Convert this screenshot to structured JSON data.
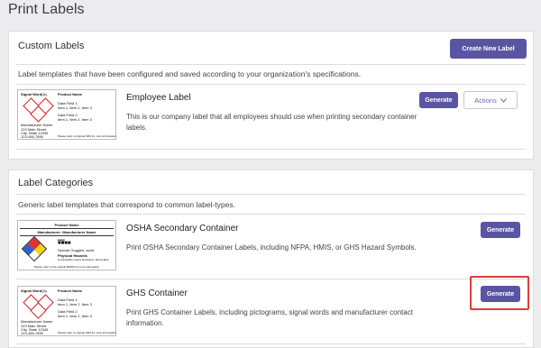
{
  "page": {
    "title": "Print Labels"
  },
  "custom": {
    "title": "Custom Labels",
    "create_label": "Create New Label",
    "description": "Label templates that have been configured and saved according to your organization's specifications.",
    "items": [
      {
        "name": "Employee Label",
        "description": "This is our company label that all employees should use when printing secondary container labels.",
        "generate": "Generate",
        "actions": "Actions",
        "thumb": {
          "signal_word": "Signal Word",
          "qty": "Qty",
          "product_name": "Product Name",
          "data_field_1": "Data Field 1:",
          "items_1": "Item 1, Item 2, Item 3",
          "data_field_2": "Data Field 2:",
          "items_2": "Item 1, Item 2, Item 3",
          "manufacturer": "Manufacturer Name",
          "address": "123 Main Street",
          "city": "City, State 12345",
          "phone": "123-456-7890",
          "footer": "Please refer to original SDS for more information"
        }
      }
    ]
  },
  "categories": {
    "title": "Label Categories",
    "description": "Generic label templates that correspond to common label-types.",
    "items": [
      {
        "name": "OSHA Secondary Container",
        "description": "Print OSHA Secondary Container Labels, including NFPA, HMIS, or GHS Hazard Symbols.",
        "generate": "Generate",
        "thumb": {
          "product_name": "Product Name",
          "manufacturer": "Manufacturer: Manufacturer Name",
          "ppe": "PPE",
          "ppe_detail": "Special Goggles, acrid",
          "physical_hazards": "Physical Hazards",
          "hazard_detail": "Combustible Liquid, Explosive, Flammable",
          "footer": "Please refer to the original MSDS for more information"
        }
      },
      {
        "name": "GHS Container",
        "description": "Print GHS Container Labels, including pictograms, signal words and manufacturer contact information.",
        "generate": "Generate",
        "thumb": {
          "signal_word": "Signal Word",
          "qty": "Qty",
          "product_name": "Product Name",
          "data_field_1": "Data Field 1:",
          "items_1": "Item 1, Item 2, Item 3",
          "data_field_2": "Data Field 2:",
          "items_2": "Item 1, Item 2, Item 3",
          "manufacturer": "Manufacturer Name",
          "address": "123 Main Street",
          "city": "City, State 12345",
          "phone": "123-456-7890",
          "footer": "Please refer to original SDS for more information"
        }
      }
    ]
  },
  "colors": {
    "primary": "#5a55a3",
    "highlight": "#e23b3b",
    "background": "#ececef"
  }
}
